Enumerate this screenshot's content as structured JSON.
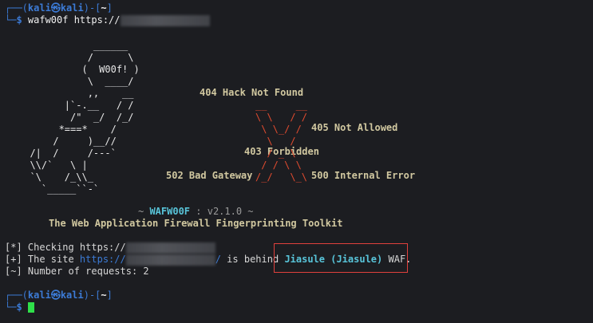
{
  "prompt": {
    "line1_prefix": "┌──(",
    "user": "kali",
    "at": "㉿",
    "host": "kali",
    "line1_suffix": ")-[",
    "dir": "~",
    "line1_end": "]",
    "line2_prefix": "└─",
    "dollar": "$ "
  },
  "command": {
    "name": "wafw00f",
    "arg": " https://"
  },
  "banner": {
    "ascii_lines": [
      "             ______",
      "            /      \\",
      "           (  W00f! )",
      "            \\  ____/",
      "            ,,    __",
      "        |`-.__   / /",
      "         /\"  _/  /_/",
      "       *===*    /",
      "      /     )__//",
      "  /|  /     /---`",
      "  \\\\/`   \\ |",
      "  `\\    /_\\\\_",
      "    `_____``-`"
    ],
    "hack": "404 Hack Not Found",
    "not_allowed": "405 Not Allowed",
    "forbidden": "403 Forbidden",
    "bad_gateway": "502 Bad Gateway",
    "internal_error": "500 Internal Error",
    "x_lines": [
      "__     __",
      "\\ \\   / /",
      " \\ \\_/ /",
      "  \\   /",
      "  / _ \\",
      " / / \\ \\",
      "/_/   \\_\\"
    ],
    "version_line_prefix": "~ ",
    "tool_name": "WAFW00F",
    "version_sep": " : ",
    "version": "v2.1.0",
    "version_line_suffix": " ~",
    "tagline": "The Web Application Firewall Fingerprinting Toolkit"
  },
  "output": {
    "checking_prefix": "[*] Checking https://",
    "site_prefix": "[+] The site ",
    "site_url": "https://",
    "site_slash": "/",
    "behind": " is behind ",
    "waf_name": "Jiasule (Jiasule)",
    "waf_suffix": " WAF.",
    "requests": "[~] Number of requests: 2"
  },
  "colors": {
    "background": "#1c1d21",
    "prompt_blue": "#3c7bd6",
    "x_red": "#e04b2f",
    "status_tan": "#d1c8a0",
    "waf_cyan": "#58c4d9",
    "cursor_green": "#2fe04a",
    "highlight_box": "#e0403c"
  }
}
